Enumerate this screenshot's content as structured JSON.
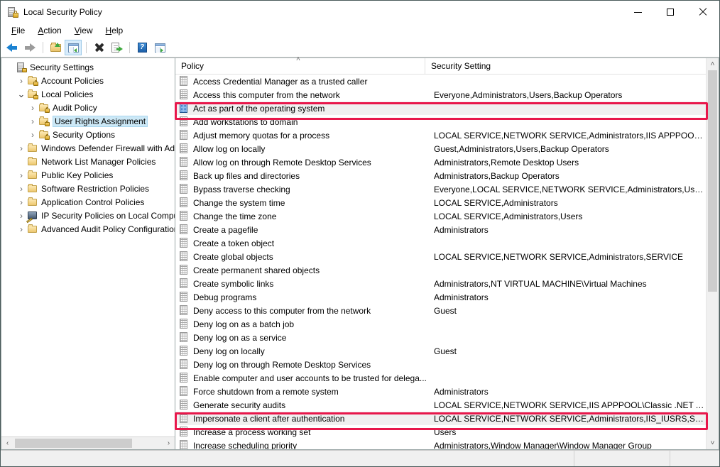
{
  "window": {
    "title": "Local Security Policy",
    "icon": "security-policy-icon",
    "controls": {
      "minimize": "—",
      "maximize": "□",
      "close": "✕"
    }
  },
  "menubar": {
    "items": [
      {
        "label": "File",
        "accel": "F"
      },
      {
        "label": "Action",
        "accel": "A"
      },
      {
        "label": "View",
        "accel": "V"
      },
      {
        "label": "Help",
        "accel": "H"
      }
    ]
  },
  "toolbar": {
    "buttons": [
      {
        "name": "back-button",
        "icon": "back-arrow-icon"
      },
      {
        "name": "forward-button",
        "icon": "forward-arrow-icon"
      },
      {
        "name": "up-one-level-button",
        "icon": "folder-up-icon"
      },
      {
        "name": "show-hide-console-tree-button",
        "icon": "console-tree-icon",
        "active": true
      },
      {
        "name": "delete-button",
        "icon": "delete-x-icon"
      },
      {
        "name": "export-list-button",
        "icon": "export-list-icon"
      },
      {
        "name": "help-button",
        "icon": "help-question-icon"
      },
      {
        "name": "show-action-pane-button",
        "icon": "action-pane-icon"
      }
    ]
  },
  "tree": {
    "items": [
      {
        "label": "Security Settings",
        "indent": 0,
        "chevron": "none",
        "icon": "security-settings-icon",
        "selected": false
      },
      {
        "label": "Account Policies",
        "indent": 1,
        "chevron": "collapsed",
        "icon": "folder-lock-icon",
        "selected": false
      },
      {
        "label": "Local Policies",
        "indent": 1,
        "chevron": "expanded",
        "icon": "folder-lock-icon",
        "selected": false
      },
      {
        "label": "Audit Policy",
        "indent": 2,
        "chevron": "collapsed",
        "icon": "folder-lock-icon",
        "selected": false
      },
      {
        "label": "User Rights Assignment",
        "indent": 2,
        "chevron": "collapsed",
        "icon": "folder-lock-icon",
        "selected": true
      },
      {
        "label": "Security Options",
        "indent": 2,
        "chevron": "collapsed",
        "icon": "folder-lock-icon",
        "selected": false
      },
      {
        "label": "Windows Defender Firewall with Adva",
        "indent": 1,
        "chevron": "collapsed",
        "icon": "folder-icon",
        "selected": false
      },
      {
        "label": "Network List Manager Policies",
        "indent": 1,
        "chevron": "none",
        "icon": "folder-icon",
        "selected": false
      },
      {
        "label": "Public Key Policies",
        "indent": 1,
        "chevron": "collapsed",
        "icon": "folder-icon",
        "selected": false
      },
      {
        "label": "Software Restriction Policies",
        "indent": 1,
        "chevron": "collapsed",
        "icon": "folder-icon",
        "selected": false
      },
      {
        "label": "Application Control Policies",
        "indent": 1,
        "chevron": "collapsed",
        "icon": "folder-icon",
        "selected": false
      },
      {
        "label": "IP Security Policies on Local Compute",
        "indent": 1,
        "chevron": "collapsed",
        "icon": "ip-security-icon",
        "selected": false
      },
      {
        "label": "Advanced Audit Policy Configuration",
        "indent": 1,
        "chevron": "collapsed",
        "icon": "folder-icon",
        "selected": false
      }
    ],
    "hscroll": {
      "left_arrow": "‹",
      "right_arrow": "›"
    }
  },
  "list": {
    "columns": [
      {
        "key": "policy",
        "label": "Policy",
        "sorted": "ascending",
        "sort_glyph": "˄"
      },
      {
        "key": "setting",
        "label": "Security Setting",
        "sorted": "none",
        "sort_glyph": ""
      }
    ],
    "rows": [
      {
        "policy": "Access Credential Manager as a trusted caller",
        "setting": "",
        "highlighted": false,
        "icon_selected": false
      },
      {
        "policy": "Access this computer from the network",
        "setting": "Everyone,Administrators,Users,Backup Operators",
        "highlighted": false,
        "icon_selected": false
      },
      {
        "policy": "Act as part of the operating system",
        "setting": "",
        "highlighted": true,
        "icon_selected": true
      },
      {
        "policy": "Add workstations to domain",
        "setting": "",
        "highlighted": false,
        "icon_selected": false
      },
      {
        "policy": "Adjust memory quotas for a process",
        "setting": "LOCAL SERVICE,NETWORK SERVICE,Administrators,IIS APPPOOL\\Class...",
        "highlighted": false,
        "icon_selected": false
      },
      {
        "policy": "Allow log on locally",
        "setting": "Guest,Administrators,Users,Backup Operators",
        "highlighted": false,
        "icon_selected": false
      },
      {
        "policy": "Allow log on through Remote Desktop Services",
        "setting": "Administrators,Remote Desktop Users",
        "highlighted": false,
        "icon_selected": false
      },
      {
        "policy": "Back up files and directories",
        "setting": "Administrators,Backup Operators",
        "highlighted": false,
        "icon_selected": false
      },
      {
        "policy": "Bypass traverse checking",
        "setting": "Everyone,LOCAL SERVICE,NETWORK SERVICE,Administrators,Users,Bac...",
        "highlighted": false,
        "icon_selected": false
      },
      {
        "policy": "Change the system time",
        "setting": "LOCAL SERVICE,Administrators",
        "highlighted": false,
        "icon_selected": false
      },
      {
        "policy": "Change the time zone",
        "setting": "LOCAL SERVICE,Administrators,Users",
        "highlighted": false,
        "icon_selected": false
      },
      {
        "policy": "Create a pagefile",
        "setting": "Administrators",
        "highlighted": false,
        "icon_selected": false
      },
      {
        "policy": "Create a token object",
        "setting": "",
        "highlighted": false,
        "icon_selected": false
      },
      {
        "policy": "Create global objects",
        "setting": "LOCAL SERVICE,NETWORK SERVICE,Administrators,SERVICE",
        "highlighted": false,
        "icon_selected": false
      },
      {
        "policy": "Create permanent shared objects",
        "setting": "",
        "highlighted": false,
        "icon_selected": false
      },
      {
        "policy": "Create symbolic links",
        "setting": "Administrators,NT VIRTUAL MACHINE\\Virtual Machines",
        "highlighted": false,
        "icon_selected": false
      },
      {
        "policy": "Debug programs",
        "setting": "Administrators",
        "highlighted": false,
        "icon_selected": false
      },
      {
        "policy": "Deny access to this computer from the network",
        "setting": "Guest",
        "highlighted": false,
        "icon_selected": false
      },
      {
        "policy": "Deny log on as a batch job",
        "setting": "",
        "highlighted": false,
        "icon_selected": false
      },
      {
        "policy": "Deny log on as a service",
        "setting": "",
        "highlighted": false,
        "icon_selected": false
      },
      {
        "policy": "Deny log on locally",
        "setting": "Guest",
        "highlighted": false,
        "icon_selected": false
      },
      {
        "policy": "Deny log on through Remote Desktop Services",
        "setting": "",
        "highlighted": false,
        "icon_selected": false
      },
      {
        "policy": "Enable computer and user accounts to be trusted for delega...",
        "setting": "",
        "highlighted": false,
        "icon_selected": false
      },
      {
        "policy": "Force shutdown from a remote system",
        "setting": "Administrators",
        "highlighted": false,
        "icon_selected": false
      },
      {
        "policy": "Generate security audits",
        "setting": "LOCAL SERVICE,NETWORK SERVICE,IIS APPPOOL\\Classic .NET AppPoo",
        "highlighted": false,
        "icon_selected": false
      },
      {
        "policy": "Impersonate a client after authentication",
        "setting": "LOCAL SERVICE,NETWORK SERVICE,Administrators,IIS_IUSRS,SERVICE",
        "highlighted": true,
        "icon_selected": false
      },
      {
        "policy": "Increase a process working set",
        "setting": "Users",
        "highlighted": false,
        "icon_selected": false
      },
      {
        "policy": "Increase scheduling priority",
        "setting": "Administrators,Window Manager\\Window Manager Group",
        "highlighted": false,
        "icon_selected": false
      }
    ],
    "vscroll": {
      "up_arrow": "˄",
      "down_arrow": "˅"
    }
  },
  "annotations": {
    "boxes": [
      {
        "name": "highlight-act-as-part-of-os",
        "color": "#e8174b"
      },
      {
        "name": "highlight-impersonate-a-client",
        "color": "#e8174b"
      }
    ]
  },
  "statusbar": {
    "segments": [
      "",
      "",
      ""
    ]
  }
}
